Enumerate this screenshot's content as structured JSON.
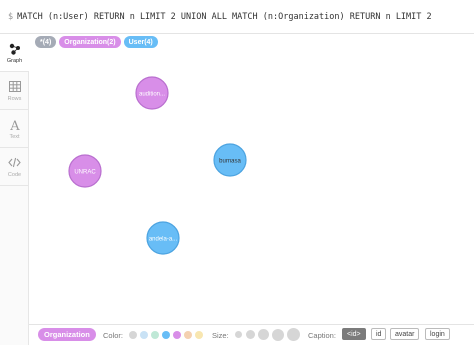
{
  "query": {
    "prompt": "$",
    "text": "MATCH (n:User) RETURN n LIMIT 2 UNION ALL MATCH (n:Organization) RETURN n LIMIT 2"
  },
  "sidebar": {
    "items": [
      {
        "label": "Graph",
        "icon": "graph-icon"
      },
      {
        "label": "Rows",
        "icon": "table-icon"
      },
      {
        "label": "Text",
        "icon": "text-icon"
      },
      {
        "label": "Code",
        "icon": "code-icon"
      }
    ]
  },
  "pills": {
    "all": "*(4)",
    "organization": "Organization(2)",
    "user": "User(4)"
  },
  "nodes": [
    {
      "caption": "audition...",
      "type": "Organization",
      "color": "#d88ee8",
      "border": "#b96fcf"
    },
    {
      "caption": "UNRAC",
      "type": "Organization",
      "color": "#d88ee8",
      "border": "#b96fcf"
    },
    {
      "caption": "burnasa",
      "type": "User",
      "color": "#68bdf6",
      "border": "#4ca3e0"
    },
    {
      "caption": "andela-a...",
      "type": "User",
      "color": "#68bdf6",
      "border": "#4ca3e0"
    }
  ],
  "footer": {
    "selected_label": "Organization",
    "color_label": "Color:",
    "size_label": "Size:",
    "caption_label": "Caption:",
    "colors": [
      "#d6d6d6",
      "#c9e2f5",
      "#bfe8d6",
      "#68bdf6",
      "#d88ee8",
      "#f4d1b0",
      "#f8e6b0"
    ],
    "caption_options": [
      "<id>",
      "id",
      "avatar",
      "login"
    ],
    "selected_caption": "<id>"
  }
}
